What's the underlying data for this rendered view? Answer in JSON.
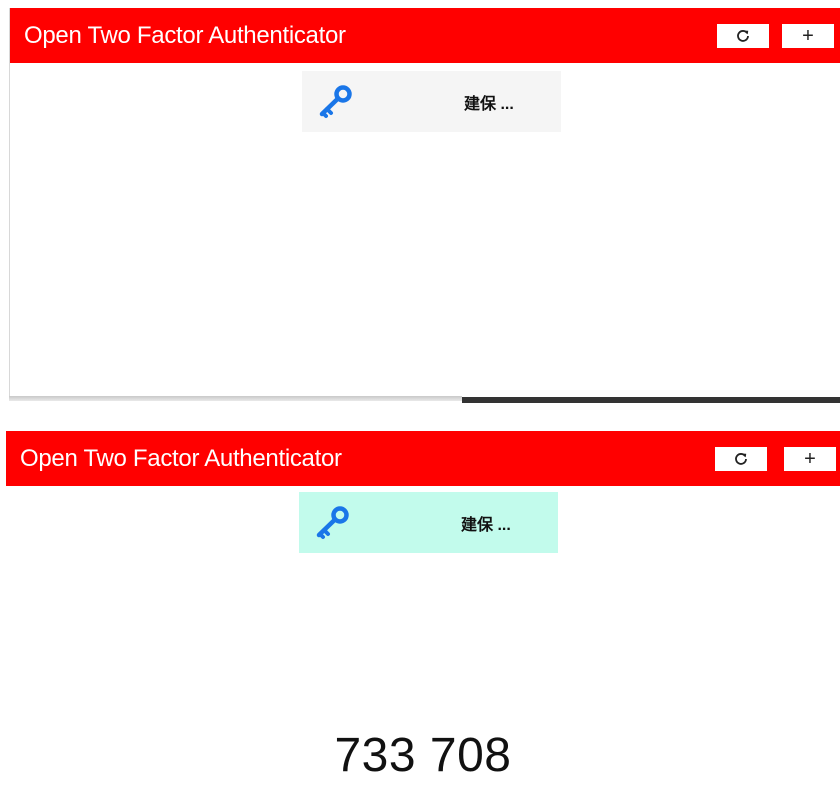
{
  "app": {
    "title": "Open Two Factor Authenticator",
    "accent_color": "#ff0000"
  },
  "header": {
    "refresh_icon": "refresh-icon",
    "add_label": "+"
  },
  "accounts": [
    {
      "icon": "key-icon",
      "label": "建保 ...",
      "state_panel1_bg": "#f5f5f5",
      "state_panel2_bg": "#c2fbec"
    }
  ],
  "otp": {
    "code": "733 708"
  }
}
